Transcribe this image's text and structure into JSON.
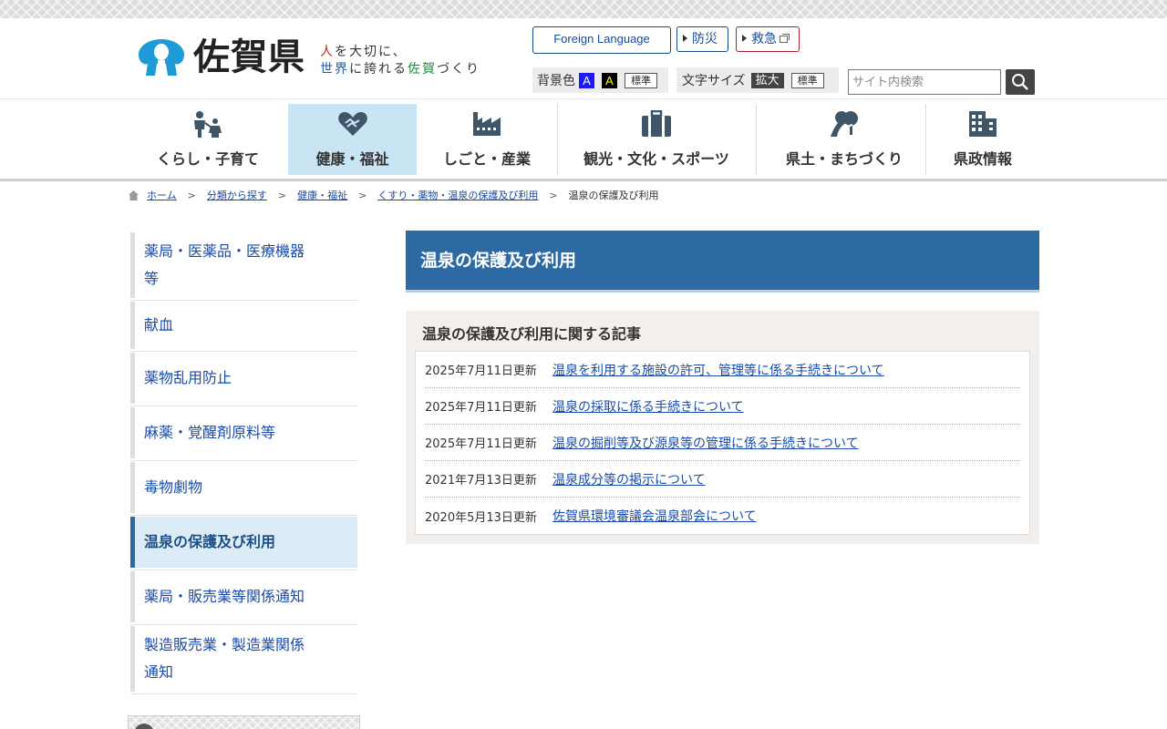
{
  "header": {
    "logo_name": "佐賀県",
    "tagline_line1": [
      {
        "text": "人",
        "tone": "r"
      },
      {
        "text": "を大切に、",
        "tone": ""
      }
    ],
    "tagline_line2": [
      {
        "text": "世界",
        "tone": "b"
      },
      {
        "text": "に誇れる",
        "tone": ""
      },
      {
        "text": "佐賀",
        "tone": "g"
      },
      {
        "text": "づくり",
        "tone": ""
      }
    ],
    "foreign_language": "Foreign Language",
    "bousai": "防災",
    "kyukyu": "救急",
    "bg_color_label": "背景色",
    "bg_blue": "A",
    "bg_black": "A",
    "bg_standard": "標準",
    "font_size_label": "文字サイズ",
    "font_enlarge": "拡大",
    "font_standard": "標準",
    "search_placeholder": "サイト内検索"
  },
  "nav": [
    {
      "label": "くらし・子育て",
      "icon": "family-icon",
      "active": false
    },
    {
      "label": "健康・福祉",
      "icon": "heart-hands-icon",
      "active": true
    },
    {
      "label": "しごと・産業",
      "icon": "factory-icon",
      "active": false
    },
    {
      "label": "観光・文化・スポーツ",
      "icon": "suitcase-icon",
      "active": false
    },
    {
      "label": "県土・まちづくり",
      "icon": "road-tree-icon",
      "active": false
    },
    {
      "label": "県政情報",
      "icon": "building-icon",
      "active": false
    }
  ],
  "breadcrumb": [
    {
      "label": "ホーム",
      "link": true
    },
    {
      "label": "分類から探す",
      "link": true
    },
    {
      "label": "健康・福祉",
      "link": true
    },
    {
      "label": "くすり・薬物・温泉の保護及び利用",
      "link": true
    },
    {
      "label": "温泉の保護及び利用",
      "link": false
    }
  ],
  "sidebar": [
    {
      "lines": [
        "薬局・医薬品・医療機器",
        "等"
      ],
      "active": false
    },
    {
      "lines": [
        "献血"
      ],
      "active": false
    },
    {
      "lines": [
        "薬物乱用防止"
      ],
      "active": false
    },
    {
      "lines": [
        "麻薬・覚醒剤原料等"
      ],
      "active": false
    },
    {
      "lines": [
        "毒物劇物"
      ],
      "active": false
    },
    {
      "lines": [
        "温泉の保護及び利用"
      ],
      "active": true
    },
    {
      "lines": [
        "薬局・販売業等関係通知"
      ],
      "active": false
    },
    {
      "lines": [
        "製造販売業・製造業関係",
        "通知"
      ],
      "active": false
    }
  ],
  "main": {
    "page_title": "温泉の保護及び利用",
    "articles_heading": "温泉の保護及び利用に関する記事",
    "articles": [
      {
        "date": "2025年7月11日更新",
        "title": "温泉を利用する施設の許可、管理等に係る手続きについて"
      },
      {
        "date": "2025年7月11日更新",
        "title": "温泉の採取に係る手続きについて"
      },
      {
        "date": "2025年7月11日更新",
        "title": "温泉の掘削等及び源泉等の管理に係る手続きについて"
      },
      {
        "date": "2021年7月13日更新",
        "title": "温泉成分等の掲示について"
      },
      {
        "date": "2020年5月13日更新",
        "title": "佐賀県環境審議会温泉部会について"
      }
    ]
  },
  "colors": {
    "brand_blue": "#2d6aa3",
    "link": "#1a4aa8",
    "nav_active": "#c9e4f3",
    "logo_blue": "#1e9ad6"
  }
}
